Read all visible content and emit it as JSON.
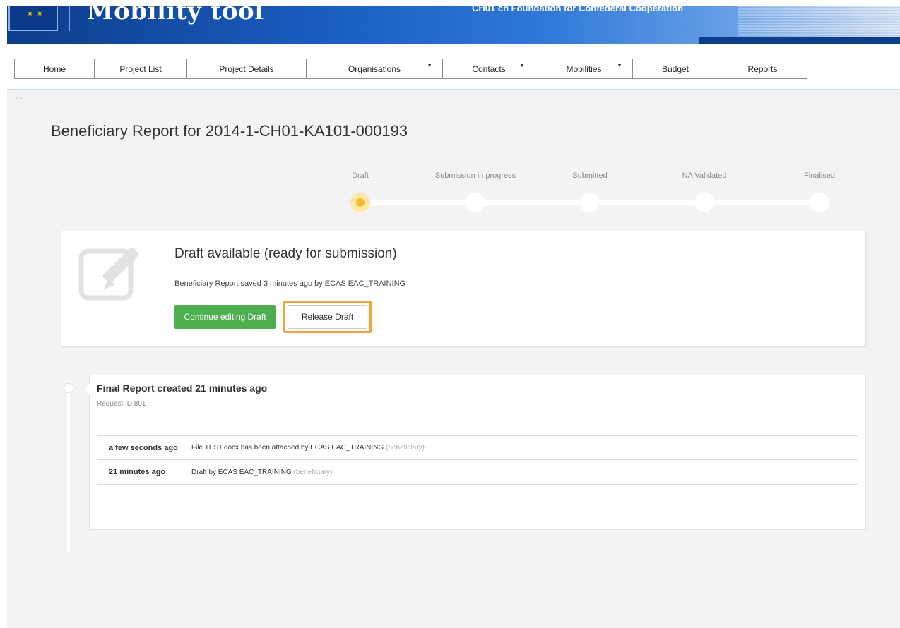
{
  "header": {
    "app_title": "Mobility tool",
    "organisation": "CH01 ch Foundation for Confederal Cooperation"
  },
  "nav": {
    "items": [
      {
        "label": "Home",
        "has_dropdown": false
      },
      {
        "label": "Project List",
        "has_dropdown": false
      },
      {
        "label": "Project Details",
        "has_dropdown": false
      },
      {
        "label": "Organisations",
        "has_dropdown": true
      },
      {
        "label": "Contacts",
        "has_dropdown": true
      },
      {
        "label": "Mobilities",
        "has_dropdown": true
      },
      {
        "label": "Budget",
        "has_dropdown": false
      },
      {
        "label": "Reports",
        "has_dropdown": false
      }
    ]
  },
  "page": {
    "title": "Beneficiary Report for 2014-1-CH01-KA101-000193"
  },
  "stepper": {
    "steps": [
      {
        "label": "Draft",
        "active": true
      },
      {
        "label": "Submission in progress",
        "active": false
      },
      {
        "label": "Submitted",
        "active": false
      },
      {
        "label": "NA Validated",
        "active": false
      },
      {
        "label": "Finalised",
        "active": false
      }
    ]
  },
  "draft": {
    "title": "Draft available (ready for submission)",
    "subtitle": "Beneficiary Report saved 3 minutes ago by ECAS EAC_TRAINING",
    "continue_label": "Continue editing Draft",
    "release_label": "Release Draft"
  },
  "history": {
    "title": "Final Report created 21 minutes ago",
    "request_id": "Request ID 801",
    "rows": [
      {
        "time": "a few seconds ago",
        "message": "File TEST.docx has been attached by ECAS EAC_TRAINING",
        "role": "(beneficiary)"
      },
      {
        "time": "21 minutes ago",
        "message": "Draft by ECAS EAC_TRAINING",
        "role": "(beneficiary)"
      }
    ]
  },
  "colors": {
    "active_step": "#f5b82e",
    "continue_button": "#4cae4c",
    "highlight_border": "#f0a53a"
  }
}
